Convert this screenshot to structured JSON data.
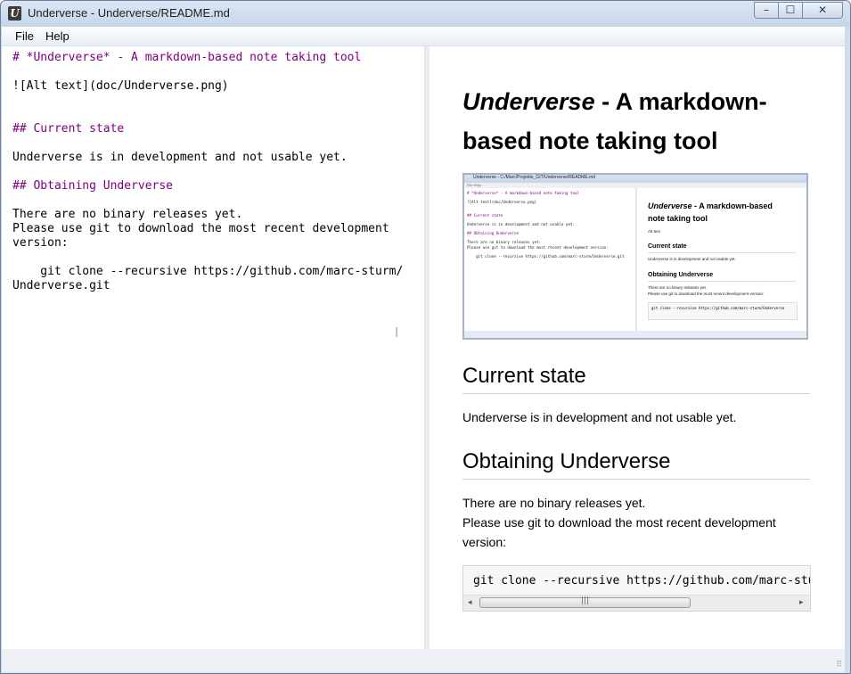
{
  "window": {
    "title": "Underverse - Underverse/README.md",
    "app_icon": "U"
  },
  "window_controls": {
    "minimize": "–",
    "maximize": "☐",
    "close": "✕"
  },
  "menu": {
    "file": "File",
    "help": "Help"
  },
  "editor": {
    "lines": [
      "# *Underverse* - A markdown-based note taking tool",
      "![Alt text](doc/Underverse.png)",
      "## Current state",
      "Underverse is in development and not usable yet.",
      "## Obtaining Underverse",
      "There are no binary releases yet.",
      "Please use git to download the most recent development",
      "version:",
      "    git clone --recursive https://github.com/marc-sturm/",
      "Underverse.git"
    ],
    "cursor": "I"
  },
  "preview": {
    "title_italic": "Underverse",
    "title_rest": " - A markdown-based note taking tool",
    "section1_heading": "Current state",
    "section1_text": "Underverse is in development and not usable yet.",
    "section2_heading": "Obtaining Underverse",
    "section2_line1": "There are no binary releases yet.",
    "section2_line2": "Please use git to download the most recent development",
    "section2_line3": "version:",
    "code": "git clone --recursive https://github.com/marc-sturm/Underverse.git",
    "scroll_left": "◂",
    "scroll_grip": "|||",
    "scroll_right": "▸"
  },
  "screenshot_image": {
    "title": "Underverse - C:/Marc/Projekte_GIT/Underverse/README.md",
    "menu": "File  Help",
    "code_lines": [
      "# *Underverse* - A markdown-based note taking tool",
      "![Alt text](doc/Underverse.png)",
      "## Current state",
      "Underverse is in development and not usable yet.",
      "## Obtaining Underverse",
      "There are no binary releases yet.",
      "Please use git to download the most recent development version:",
      "    git clone --recursive https://github.com/marc-sturm/Underverse.git"
    ],
    "h1_italic": "Underverse",
    "h1_rest": " - A markdown-based note taking tool",
    "alt_text": "Alt text",
    "h2_current": "Current state",
    "p_current": "Underverse is in development and not usable yet.",
    "h2_obtaining": "Obtaining Underverse",
    "p_obtaining1": "There are no binary releases yet.",
    "p_obtaining2": "Please use git to download the most recent development version:",
    "code": "git clone --recursive https://github.com/marc-sturm/Underverse"
  },
  "status": {
    "grip": "⠿"
  }
}
